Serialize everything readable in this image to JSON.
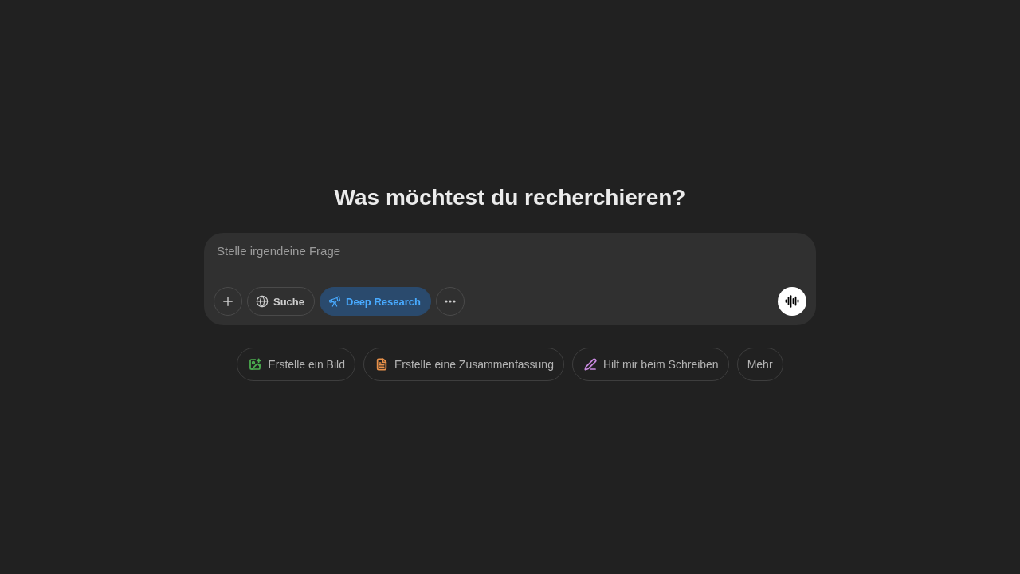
{
  "heading": "Was möchtest du recherchieren?",
  "composer": {
    "placeholder": "Stelle irgendeine Frage",
    "tools": [
      {
        "kind": "add",
        "selected": false
      },
      {
        "kind": "search",
        "label": "Suche",
        "selected": false
      },
      {
        "kind": "research",
        "label": "Deep Research",
        "selected": true
      },
      {
        "kind": "more",
        "selected": false
      }
    ]
  },
  "suggestions": [
    {
      "kind": "image",
      "label": "Erstelle ein Bild",
      "color": "#4caf50"
    },
    {
      "kind": "summary",
      "label": "Erstelle eine Zusammenfassung",
      "color": "#e8914a"
    },
    {
      "kind": "write",
      "label": "Hilf mir beim Schreiben",
      "color": "#c98ae0"
    },
    {
      "kind": "plain",
      "label": "Mehr"
    }
  ]
}
